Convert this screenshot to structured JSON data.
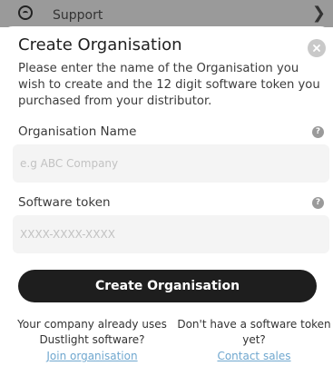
{
  "background_list": {
    "item_label": "Support"
  },
  "dialog": {
    "title": "Create Organisation",
    "description": "Please enter the name of the Organisation you wish to create and the 12 digit software token you purchased from your distributor.",
    "org_name": {
      "label": "Organisation Name",
      "value": "",
      "placeholder": "e.g ABC Company"
    },
    "token": {
      "label": "Software token",
      "value": "",
      "placeholder": "XXXX-XXXX-XXXX"
    },
    "submit_label": "Create Organisation",
    "join": {
      "text": "Your company already uses Dustlight software?",
      "link": "Join organisation"
    },
    "contact": {
      "text": "Don't have a software token yet?",
      "link": "Contact sales"
    }
  },
  "icons": {
    "background_item": "support-icon",
    "chevron": "chevron-right-icon",
    "close": "close-icon",
    "help": "help-icon"
  },
  "colors": {
    "primary_button": "#1e1e1e",
    "link": "#6fa7cf",
    "input_bg": "#f4f4f4",
    "overlay_row": "#9a9a9a"
  }
}
